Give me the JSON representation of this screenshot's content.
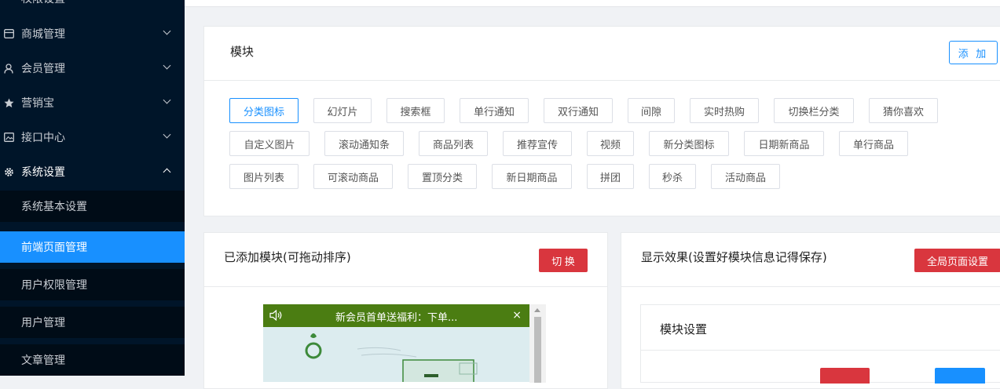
{
  "sidebar": {
    "top_partial": "权限设置",
    "menus": [
      {
        "label": "商城管理",
        "icon": "store-icon",
        "open": false
      },
      {
        "label": "会员管理",
        "icon": "user-icon",
        "open": false
      },
      {
        "label": "营销宝",
        "icon": "star-icon",
        "open": false
      },
      {
        "label": "接口中心",
        "icon": "image-icon",
        "open": false
      },
      {
        "label": "系统设置",
        "icon": "gear-icon",
        "open": true
      }
    ],
    "submenu": [
      {
        "label": "系统基本设置",
        "active": false
      },
      {
        "label": "前端页面管理",
        "active": true
      },
      {
        "label": "用户权限管理",
        "active": false
      },
      {
        "label": "用户管理",
        "active": false
      },
      {
        "label": "文章管理",
        "active": false
      }
    ]
  },
  "modules": {
    "title": "模块",
    "add_label": "添 加",
    "row1": [
      "分类图标",
      "幻灯片",
      "搜索框",
      "单行通知",
      "双行通知",
      "间隙",
      "实时热购",
      "切换栏分类",
      "猜你喜欢"
    ],
    "row2": [
      "自定义图片",
      "滚动通知条",
      "商品列表",
      "推荐宣传",
      "视频",
      "新分类图标",
      "日期新商品",
      "单行商品"
    ],
    "row3": [
      "图片列表",
      "可滚动商品",
      "置顶分类",
      "新日期商品",
      "拼团",
      "秒杀",
      "活动商品"
    ],
    "selected": "分类图标"
  },
  "added": {
    "title": "已添加模块(可拖动排序)",
    "switch_label": "切 换",
    "notice_text": "新会员首单送福利：下单...",
    "close_glyph": "×"
  },
  "preview": {
    "title": "显示效果(设置好模块信息记得保存)",
    "global_label": "全局页面设置",
    "settings_title": "模块设置"
  },
  "colors": {
    "sidebar_bg": "#001529",
    "active": "#1890ff",
    "danger": "#d9363e",
    "notice_bg": "#4b7d12"
  }
}
